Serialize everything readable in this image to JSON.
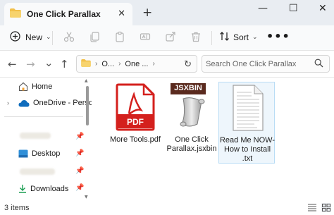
{
  "window": {
    "tab_title": "One Click Parallax",
    "tab_close_icon": "close-icon",
    "new_tab_symbol": "+",
    "controls": {
      "minimize": "—",
      "maximize": "☐",
      "close": "✕"
    }
  },
  "toolbar": {
    "new_label": "New",
    "sort_label": "Sort",
    "more_symbol": "•••",
    "dropdown_symbol": "⌄"
  },
  "navigation": {
    "back": "←",
    "forward": "→",
    "history": "⌄",
    "up": "↑",
    "breadcrumbs": [
      "O...",
      "One ..."
    ],
    "crumb_sep": "›",
    "refresh": "↻",
    "search_placeholder": "Search One Click Parallax"
  },
  "sidebar": {
    "home": "Home",
    "onedrive": "OneDrive - Persona",
    "desktop": "Desktop",
    "downloads": "Downloads"
  },
  "files": [
    {
      "name": "More Tools.pdf",
      "type": "pdf",
      "badge": "PDF"
    },
    {
      "name": "One Click Parallax.jsxbin",
      "type": "jsxbin",
      "badge": "JSXBIN"
    },
    {
      "name": "Read Me NOW-How to Install .txt",
      "type": "txt",
      "badge": ""
    }
  ],
  "status": {
    "items_text": "3 items"
  },
  "colors": {
    "pdf_red": "#d4201d",
    "folder_yellow": "#f2c04a",
    "onedrive_blue": "#0f6cbd",
    "selection_bg": "#eef6fc",
    "selection_border": "#b9dcf5"
  }
}
